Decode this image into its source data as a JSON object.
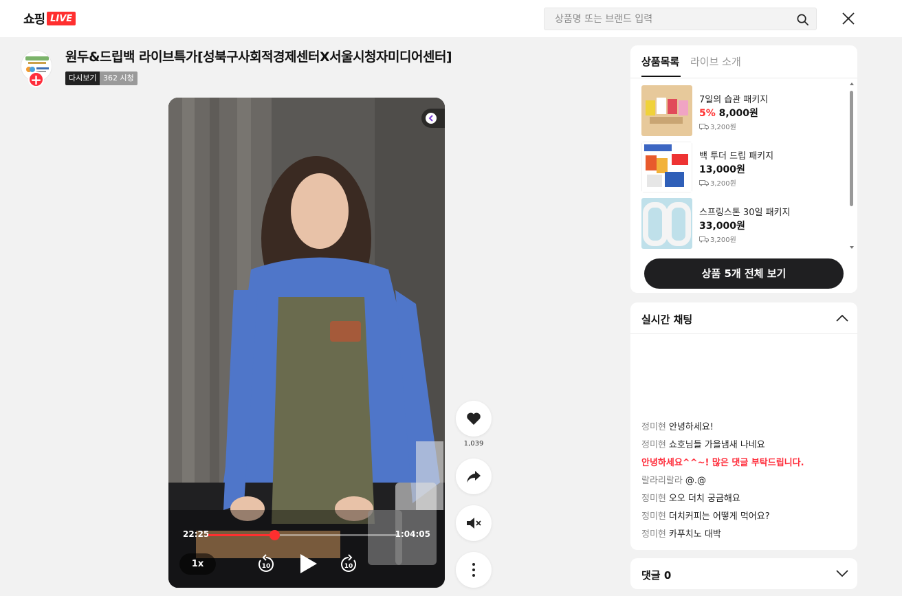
{
  "header": {
    "logo_text": "쇼핑",
    "logo_badge": "LIVE",
    "search_placeholder": "상품명 또는 브랜드 입력",
    "search_icon": "search-icon",
    "close_icon": "close-icon"
  },
  "broadcast": {
    "title": "원두&드립백 라이브특가[성북구사회적경제센터X서울시청자미디어센터]",
    "replay_badge": "다시보기",
    "views": "362 시청",
    "follow_label": "+"
  },
  "player": {
    "current_time": "22:25",
    "total_time": "1:04:05",
    "progress_fraction": 0.35,
    "speed": "1x",
    "rewind_label": "10",
    "forward_label": "10",
    "accent_color": "#ff2f2f"
  },
  "side_actions": {
    "like_count": "1,039"
  },
  "products_panel": {
    "tabs": [
      {
        "label": "상품목록",
        "active": true
      },
      {
        "label": "라이브 소개",
        "active": false
      }
    ],
    "items": [
      {
        "name": "7일의 습관 패키지",
        "discount": "5%",
        "price": "8,000원",
        "shipping": "3,200원"
      },
      {
        "name": "백 투더 드립 패키지",
        "discount": "",
        "price": "13,000원",
        "shipping": "3,200원"
      },
      {
        "name": "스프링스톤 30일 패키지",
        "discount": "",
        "price": "33,000원",
        "shipping": "3,200원"
      }
    ],
    "view_all_label": "상품 5개 전체 보기"
  },
  "chat": {
    "title": "실시간 채팅",
    "messages": [
      {
        "user": "정미현",
        "text": "안녕하세요!"
      },
      {
        "user": "정미현",
        "text": "쇼호님들 가을냄새 나네요"
      },
      {
        "user": "",
        "text": "안녕하세요^^~! 많은 댓글 부탁드립니다."
      },
      {
        "user": "랄라리랄라",
        "text": "@.@"
      },
      {
        "user": "정미현",
        "text": "오오 더치 궁금해요"
      },
      {
        "user": "정미현",
        "text": "더치커피는 어떻게 먹어요?"
      },
      {
        "user": "정미현",
        "text": "카푸치노 대박"
      }
    ]
  },
  "comments": {
    "title": "댓글 0"
  }
}
